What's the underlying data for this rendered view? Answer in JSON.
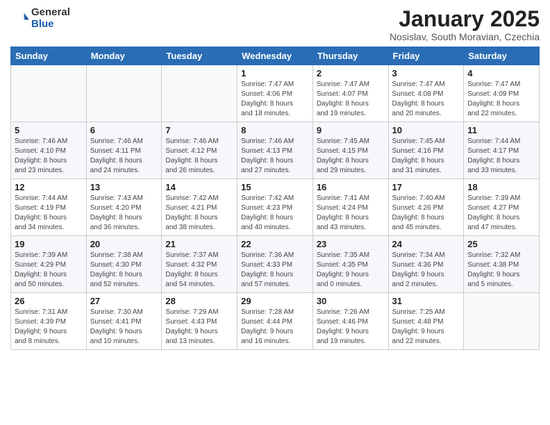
{
  "header": {
    "logo_general": "General",
    "logo_blue": "Blue",
    "month_title": "January 2025",
    "location": "Nosislav, South Moravian, Czechia"
  },
  "calendar": {
    "days_of_week": [
      "Sunday",
      "Monday",
      "Tuesday",
      "Wednesday",
      "Thursday",
      "Friday",
      "Saturday"
    ],
    "weeks": [
      [
        {
          "day": "",
          "info": ""
        },
        {
          "day": "",
          "info": ""
        },
        {
          "day": "",
          "info": ""
        },
        {
          "day": "1",
          "info": "Sunrise: 7:47 AM\nSunset: 4:06 PM\nDaylight: 8 hours\nand 18 minutes."
        },
        {
          "day": "2",
          "info": "Sunrise: 7:47 AM\nSunset: 4:07 PM\nDaylight: 8 hours\nand 19 minutes."
        },
        {
          "day": "3",
          "info": "Sunrise: 7:47 AM\nSunset: 4:08 PM\nDaylight: 8 hours\nand 20 minutes."
        },
        {
          "day": "4",
          "info": "Sunrise: 7:47 AM\nSunset: 4:09 PM\nDaylight: 8 hours\nand 22 minutes."
        }
      ],
      [
        {
          "day": "5",
          "info": "Sunrise: 7:46 AM\nSunset: 4:10 PM\nDaylight: 8 hours\nand 23 minutes."
        },
        {
          "day": "6",
          "info": "Sunrise: 7:46 AM\nSunset: 4:11 PM\nDaylight: 8 hours\nand 24 minutes."
        },
        {
          "day": "7",
          "info": "Sunrise: 7:46 AM\nSunset: 4:12 PM\nDaylight: 8 hours\nand 26 minutes."
        },
        {
          "day": "8",
          "info": "Sunrise: 7:46 AM\nSunset: 4:13 PM\nDaylight: 8 hours\nand 27 minutes."
        },
        {
          "day": "9",
          "info": "Sunrise: 7:45 AM\nSunset: 4:15 PM\nDaylight: 8 hours\nand 29 minutes."
        },
        {
          "day": "10",
          "info": "Sunrise: 7:45 AM\nSunset: 4:16 PM\nDaylight: 8 hours\nand 31 minutes."
        },
        {
          "day": "11",
          "info": "Sunrise: 7:44 AM\nSunset: 4:17 PM\nDaylight: 8 hours\nand 33 minutes."
        }
      ],
      [
        {
          "day": "12",
          "info": "Sunrise: 7:44 AM\nSunset: 4:19 PM\nDaylight: 8 hours\nand 34 minutes."
        },
        {
          "day": "13",
          "info": "Sunrise: 7:43 AM\nSunset: 4:20 PM\nDaylight: 8 hours\nand 36 minutes."
        },
        {
          "day": "14",
          "info": "Sunrise: 7:42 AM\nSunset: 4:21 PM\nDaylight: 8 hours\nand 38 minutes."
        },
        {
          "day": "15",
          "info": "Sunrise: 7:42 AM\nSunset: 4:23 PM\nDaylight: 8 hours\nand 40 minutes."
        },
        {
          "day": "16",
          "info": "Sunrise: 7:41 AM\nSunset: 4:24 PM\nDaylight: 8 hours\nand 43 minutes."
        },
        {
          "day": "17",
          "info": "Sunrise: 7:40 AM\nSunset: 4:26 PM\nDaylight: 8 hours\nand 45 minutes."
        },
        {
          "day": "18",
          "info": "Sunrise: 7:39 AM\nSunset: 4:27 PM\nDaylight: 8 hours\nand 47 minutes."
        }
      ],
      [
        {
          "day": "19",
          "info": "Sunrise: 7:39 AM\nSunset: 4:29 PM\nDaylight: 8 hours\nand 50 minutes."
        },
        {
          "day": "20",
          "info": "Sunrise: 7:38 AM\nSunset: 4:30 PM\nDaylight: 8 hours\nand 52 minutes."
        },
        {
          "day": "21",
          "info": "Sunrise: 7:37 AM\nSunset: 4:32 PM\nDaylight: 8 hours\nand 54 minutes."
        },
        {
          "day": "22",
          "info": "Sunrise: 7:36 AM\nSunset: 4:33 PM\nDaylight: 8 hours\nand 57 minutes."
        },
        {
          "day": "23",
          "info": "Sunrise: 7:35 AM\nSunset: 4:35 PM\nDaylight: 9 hours\nand 0 minutes."
        },
        {
          "day": "24",
          "info": "Sunrise: 7:34 AM\nSunset: 4:36 PM\nDaylight: 9 hours\nand 2 minutes."
        },
        {
          "day": "25",
          "info": "Sunrise: 7:32 AM\nSunset: 4:38 PM\nDaylight: 9 hours\nand 5 minutes."
        }
      ],
      [
        {
          "day": "26",
          "info": "Sunrise: 7:31 AM\nSunset: 4:39 PM\nDaylight: 9 hours\nand 8 minutes."
        },
        {
          "day": "27",
          "info": "Sunrise: 7:30 AM\nSunset: 4:41 PM\nDaylight: 9 hours\nand 10 minutes."
        },
        {
          "day": "28",
          "info": "Sunrise: 7:29 AM\nSunset: 4:43 PM\nDaylight: 9 hours\nand 13 minutes."
        },
        {
          "day": "29",
          "info": "Sunrise: 7:28 AM\nSunset: 4:44 PM\nDaylight: 9 hours\nand 16 minutes."
        },
        {
          "day": "30",
          "info": "Sunrise: 7:26 AM\nSunset: 4:46 PM\nDaylight: 9 hours\nand 19 minutes."
        },
        {
          "day": "31",
          "info": "Sunrise: 7:25 AM\nSunset: 4:48 PM\nDaylight: 9 hours\nand 22 minutes."
        },
        {
          "day": "",
          "info": ""
        }
      ]
    ]
  }
}
